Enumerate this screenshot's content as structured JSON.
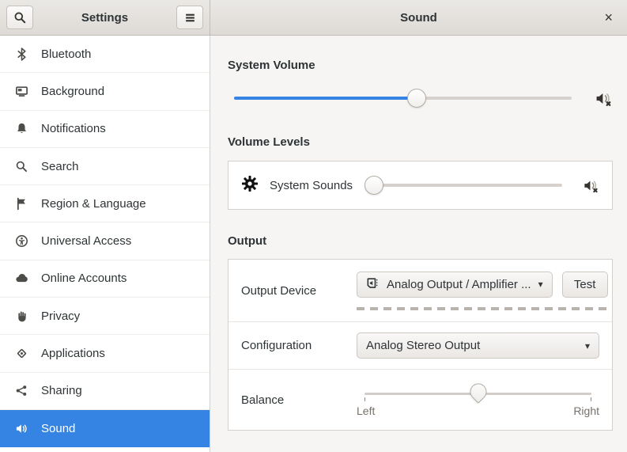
{
  "header": {
    "left_title": "Settings",
    "right_title": "Sound",
    "close_glyph": "×"
  },
  "sidebar": {
    "selected_index": 10,
    "items": [
      {
        "label": "Bluetooth",
        "icon": "bluetooth-icon"
      },
      {
        "label": "Background",
        "icon": "background-icon"
      },
      {
        "label": "Notifications",
        "icon": "notifications-icon"
      },
      {
        "label": "Search",
        "icon": "search-icon"
      },
      {
        "label": "Region & Language",
        "icon": "region-language-icon"
      },
      {
        "label": "Universal Access",
        "icon": "universal-access-icon"
      },
      {
        "label": "Online Accounts",
        "icon": "online-accounts-icon"
      },
      {
        "label": "Privacy",
        "icon": "privacy-icon"
      },
      {
        "label": "Applications",
        "icon": "applications-icon"
      },
      {
        "label": "Sharing",
        "icon": "sharing-icon"
      },
      {
        "label": "Sound",
        "icon": "sound-icon"
      }
    ]
  },
  "panel": {
    "system_volume": {
      "heading": "System Volume",
      "value_percent": 54,
      "mute_icon": "volume-muted-icon"
    },
    "volume_levels": {
      "heading": "Volume Levels",
      "rows": [
        {
          "label": "System Sounds",
          "value_percent": 3,
          "icon": "gear-icon",
          "mute_icon": "volume-muted-icon"
        }
      ]
    },
    "output": {
      "heading": "Output",
      "device": {
        "label": "Output Device",
        "value": "Analog Output / Amplifier ...",
        "arrow": "▾",
        "test_label": "Test",
        "icon": "soundcard-icon"
      },
      "configuration": {
        "label": "Configuration",
        "value": "Analog Stereo Output",
        "arrow": "▾"
      },
      "balance": {
        "label": "Balance",
        "left": "Left",
        "right": "Right",
        "value_percent": 50
      }
    }
  },
  "colors": {
    "accent": "#3584e4",
    "content_bg": "#f6f5f4",
    "card_border": "#d5d0cb",
    "header_border": "#c2bcb6"
  }
}
